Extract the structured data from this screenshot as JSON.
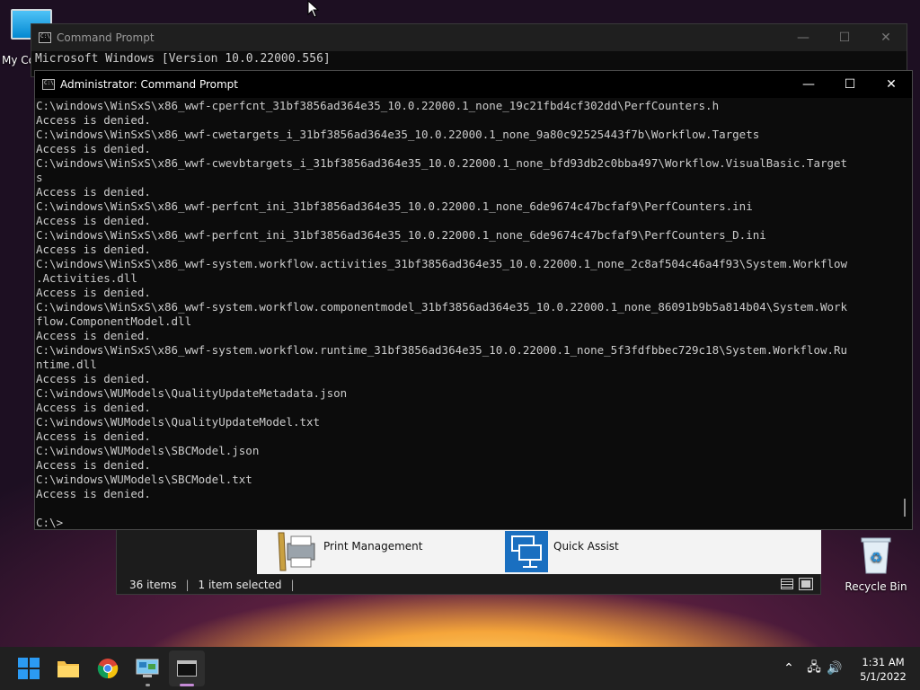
{
  "desktop": {
    "my_computer_label": "My Co",
    "recycle_bin_label": "Recycle Bin"
  },
  "back_cmd": {
    "title": "Command Prompt",
    "line1": "Microsoft Windows [Version 10.0.22000.556]"
  },
  "explorer": {
    "items": [
      {
        "label": "Print Management",
        "icon": "printer-icon"
      },
      {
        "label": "Quick Assist",
        "icon": "quick-assist-icon"
      }
    ],
    "status_items": "36 items",
    "status_selected": "1 item selected"
  },
  "admin_cmd": {
    "title": "Administrator: Command Prompt",
    "lines": [
      "C:\\windows\\WinSxS\\x86_wwf-cperfcnt_31bf3856ad364e35_10.0.22000.1_none_19c21fbd4cf302dd\\PerfCounters.h",
      "Access is denied.",
      "C:\\windows\\WinSxS\\x86_wwf-cwetargets_i_31bf3856ad364e35_10.0.22000.1_none_9a80c92525443f7b\\Workflow.Targets",
      "Access is denied.",
      "C:\\windows\\WinSxS\\x86_wwf-cwevbtargets_i_31bf3856ad364e35_10.0.22000.1_none_bfd93db2c0bba497\\Workflow.VisualBasic.Target",
      "s",
      "Access is denied.",
      "C:\\windows\\WinSxS\\x86_wwf-perfcnt_ini_31bf3856ad364e35_10.0.22000.1_none_6de9674c47bcfaf9\\PerfCounters.ini",
      "Access is denied.",
      "C:\\windows\\WinSxS\\x86_wwf-perfcnt_ini_31bf3856ad364e35_10.0.22000.1_none_6de9674c47bcfaf9\\PerfCounters_D.ini",
      "Access is denied.",
      "C:\\windows\\WinSxS\\x86_wwf-system.workflow.activities_31bf3856ad364e35_10.0.22000.1_none_2c8af504c46a4f93\\System.Workflow",
      ".Activities.dll",
      "Access is denied.",
      "C:\\windows\\WinSxS\\x86_wwf-system.workflow.componentmodel_31bf3856ad364e35_10.0.22000.1_none_86091b9b5a814b04\\System.Work",
      "flow.ComponentModel.dll",
      "Access is denied.",
      "C:\\windows\\WinSxS\\x86_wwf-system.workflow.runtime_31bf3856ad364e35_10.0.22000.1_none_5f3fdfbbec729c18\\System.Workflow.Ru",
      "ntime.dll",
      "Access is denied.",
      "C:\\windows\\WUModels\\QualityUpdateMetadata.json",
      "Access is denied.",
      "C:\\windows\\WUModels\\QualityUpdateModel.txt",
      "Access is denied.",
      "C:\\windows\\WUModels\\SBCModel.json",
      "Access is denied.",
      "C:\\windows\\WUModels\\SBCModel.txt",
      "Access is denied.",
      "",
      "C:\\>"
    ]
  },
  "window_controls": {
    "minimize": "—",
    "maximize": "☐",
    "close": "✕"
  },
  "taskbar": {
    "time": "1:31 AM",
    "date": "5/1/2022"
  },
  "colors": {
    "terminal_bg": "#0c0c0c",
    "terminal_text": "#cccccc",
    "taskbar_bg": "#202020",
    "accent": "#0078d4"
  }
}
